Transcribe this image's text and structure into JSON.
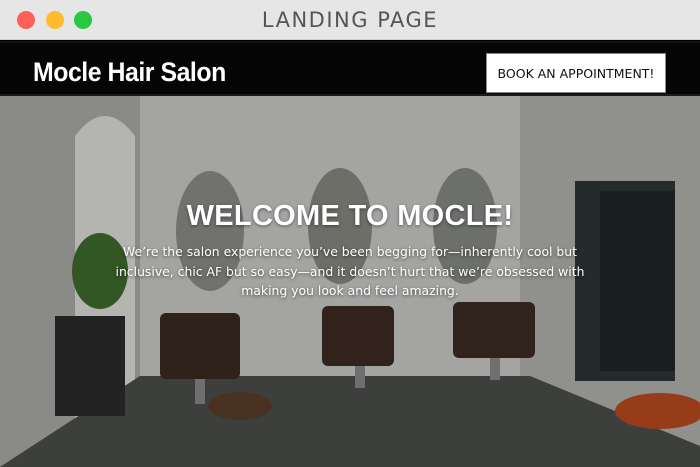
{
  "window": {
    "title": "LANDING PAGE"
  },
  "header": {
    "brand": "Mocle Hair Salon",
    "cta_label": "BOOK AN APPOINTMENT!"
  },
  "hero": {
    "title": "WELCOME TO MOCLE!",
    "text": "We’re the salon experience you’ve been begging for—inherently cool but inclusive, chic AF but so easy—and it doesn’t hurt that we’re obsessed with making you look and feel amazing."
  },
  "colors": {
    "titlebar_bg": "#e6e6e6",
    "close": "#fe5f57",
    "minimize": "#febc2e",
    "maximize": "#28c840",
    "navbar_bg": "#050505",
    "cta_bg": "#ffffff"
  }
}
